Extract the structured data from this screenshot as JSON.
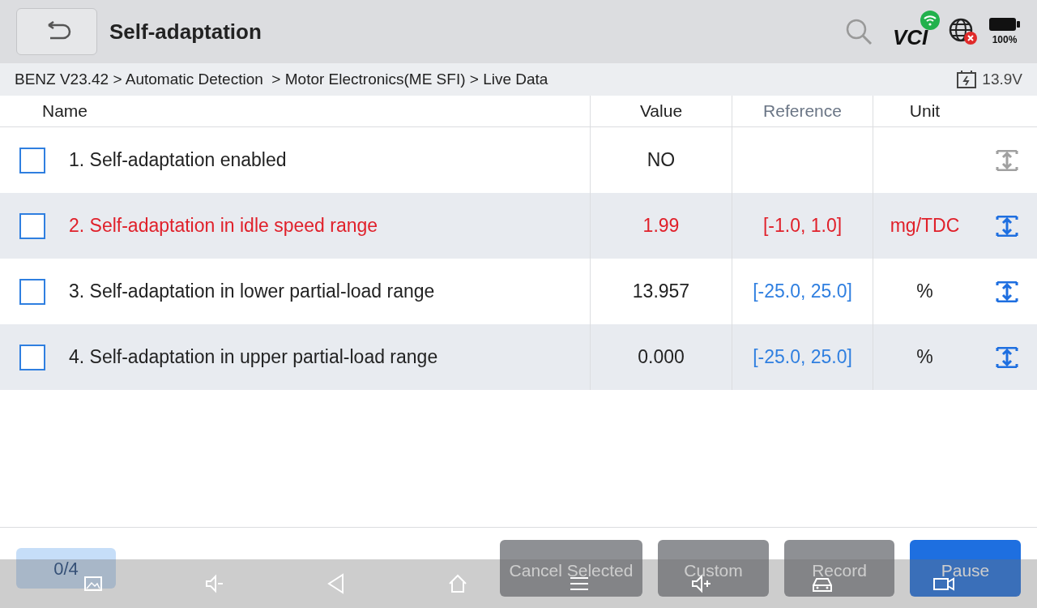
{
  "header": {
    "title": "Self-adaptation",
    "battery_label": "100%",
    "vci_label": "VCI"
  },
  "breadcrumb": {
    "path": "BENZ V23.42 > Automatic Detection  > Motor Electronics(ME SFI) > Live Data",
    "voltage": "13.9V"
  },
  "table": {
    "columns": [
      "Name",
      "Value",
      "Reference",
      "Unit"
    ],
    "rows": [
      {
        "name": "1. Self-adaptation enabled",
        "value": "NO",
        "checked": false,
        "out_of_range": false,
        "graph_enabled": false
      },
      {
        "name": "2. Self-adaptation in idle speed range",
        "value": "1.99",
        "reference": "[-1.0, 1.0]",
        "unit": "mg/TDC",
        "checked": false,
        "out_of_range": true,
        "graph_enabled": true
      },
      {
        "name": "3. Self-adaptation in lower partial-load range",
        "value": "13.957",
        "reference": "[-25.0, 25.0]",
        "unit": "%",
        "checked": false,
        "out_of_range": false,
        "graph_enabled": true
      },
      {
        "name": "4. Self-adaptation in upper partial-load range",
        "value": "0.000",
        "reference": "[-25.0, 25.0]",
        "unit": "%",
        "checked": false,
        "out_of_range": false,
        "graph_enabled": true
      }
    ]
  },
  "footer": {
    "count": "0/4",
    "buttons": [
      {
        "label": "Cancel Selected",
        "kind": "secondary"
      },
      {
        "label": "Custom",
        "kind": "secondary"
      },
      {
        "label": "Record",
        "kind": "secondary"
      },
      {
        "label": "Pause",
        "kind": "primary"
      }
    ]
  }
}
